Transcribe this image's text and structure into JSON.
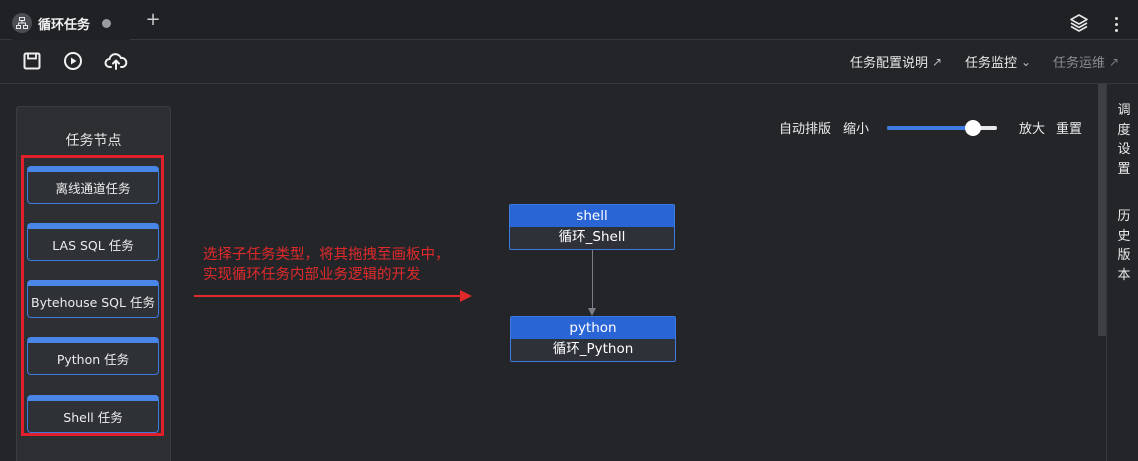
{
  "tab": {
    "title": "循环任务",
    "add_label": "+"
  },
  "toolbar": {
    "links": [
      {
        "label": "任务配置说明",
        "icon": "external-link-arrow"
      },
      {
        "label": "任务监控",
        "icon": "chevron-down"
      },
      {
        "label": "任务运维",
        "icon": "external-link-arrow",
        "disabled": true
      }
    ]
  },
  "palette": {
    "title": "任务节点",
    "items": [
      "离线通道任务",
      "LAS SQL 任务",
      "Bytehouse SQL 任务",
      "Python 任务",
      "Shell 任务"
    ]
  },
  "canvas": {
    "auto_layout": "自动排版",
    "zoom_out": "缩小",
    "zoom_in": "放大",
    "reset": "重置",
    "zoom_level": 0.78
  },
  "annotation": {
    "line1": "选择子任务类型，将其拖拽至画板中，",
    "line2": "实现循环任务内部业务逻辑的开发"
  },
  "nodes": [
    {
      "type": "shell",
      "name": "循环_Shell"
    },
    {
      "type": "python",
      "name": "循环_Python"
    }
  ],
  "side_panel": {
    "tabs": [
      "调度设置",
      "历史版本"
    ]
  },
  "colors": {
    "accent": "#2a65d6",
    "annotation": "#e02a2a",
    "background": "#232529"
  }
}
